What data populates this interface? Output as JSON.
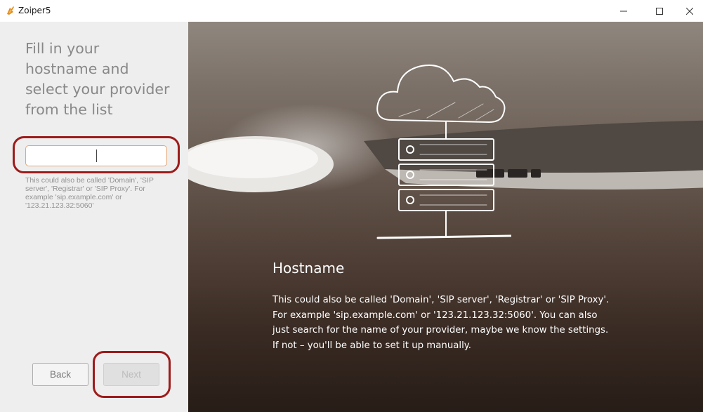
{
  "window": {
    "title": "Zoiper5",
    "controls": {
      "minimize": "minimize-icon",
      "maximize": "maximize-icon",
      "close": "close-icon"
    }
  },
  "left_panel": {
    "instruction": "Fill in your hostname and select your provider from the list",
    "hostname_input": {
      "value": "",
      "placeholder": ""
    },
    "hint": "This could also be called 'Domain', 'SIP server', 'Registrar' or 'SIP Proxy'. For example 'sip.example.com' or '123.21.123.32:5060'",
    "buttons": {
      "back": "Back",
      "next": "Next"
    }
  },
  "right_panel": {
    "title": "Hostname",
    "description": "This could also be called 'Domain', 'SIP server', 'Registrar' or 'SIP Proxy'. For example 'sip.example.com' or '123.21.123.32:5060'. You can also just search for the name of your provider, maybe we know the settings. If not – you'll be able to set it up manually."
  },
  "colors": {
    "highlight_ring": "#9d1b1b",
    "input_border": "#e4a676",
    "left_bg": "#eeeeee"
  }
}
